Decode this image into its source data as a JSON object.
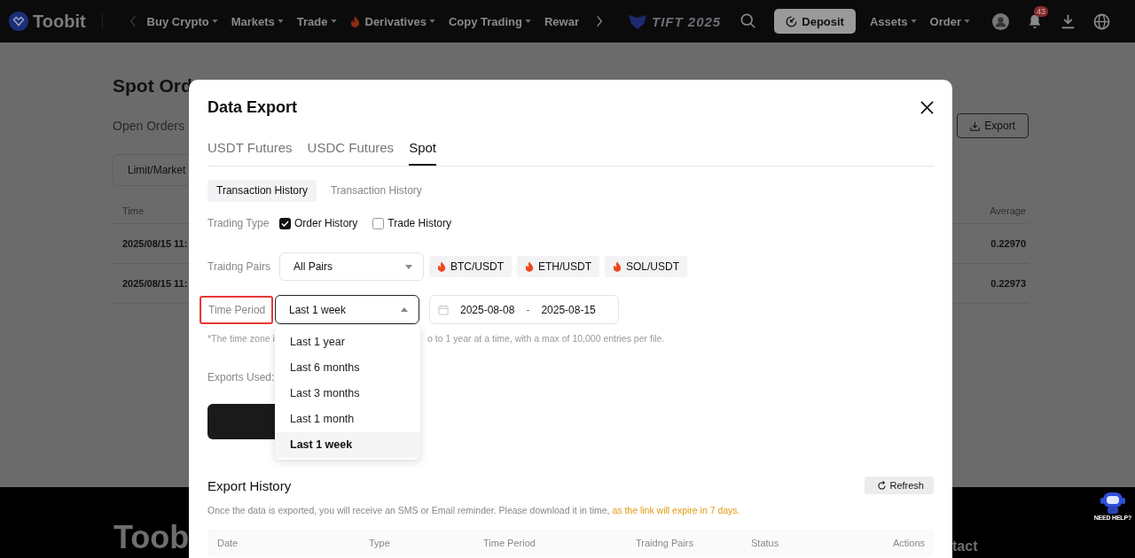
{
  "nav": {
    "logo": "Toobit",
    "items": [
      {
        "label": "Buy Crypto",
        "caret": true,
        "hot": false
      },
      {
        "label": "Markets",
        "caret": true,
        "hot": false
      },
      {
        "label": "Trade",
        "caret": true,
        "hot": false
      },
      {
        "label": "Derivatives",
        "caret": true,
        "hot": true
      },
      {
        "label": "Copy Trading",
        "caret": true,
        "hot": false
      },
      {
        "label": "Rewar",
        "caret": false,
        "hot": false
      }
    ],
    "event_logo": "TIFT 2025",
    "deposit": "Deposit",
    "menus": [
      "Assets",
      "Order"
    ],
    "notification_count": "43"
  },
  "page": {
    "title": "Spot Ord",
    "tab": "Open Orders",
    "export": "Export",
    "filter": "Limit/Market",
    "columns": [
      "Time",
      "Average"
    ],
    "rows": [
      {
        "time": "2025/08/15 11:",
        "average": "0.22970"
      },
      {
        "time": "2025/08/15 11:",
        "average": "0.22973"
      }
    ]
  },
  "footer": {
    "brand": "Toob",
    "link": "tact"
  },
  "help_badge": "NEED HELP?",
  "modal": {
    "title": "Data Export",
    "tabs": [
      {
        "label": "USDT Futures",
        "selected": false
      },
      {
        "label": "USDC Futures",
        "selected": false
      },
      {
        "label": "Spot",
        "selected": true
      }
    ],
    "sub_tabs": [
      {
        "label": "Transaction History",
        "selected": true
      },
      {
        "label": "Transaction History",
        "selected": false
      }
    ],
    "trading_type": {
      "label": "Trading Type",
      "options": [
        {
          "label": "Order History",
          "checked": true
        },
        {
          "label": "Trade History",
          "checked": false
        }
      ]
    },
    "pairs": {
      "label": "Traidng Pairs",
      "value": "All Pairs",
      "hot": [
        "BTC/USDT",
        "ETH/USDT",
        "SOL/USDT"
      ]
    },
    "period": {
      "label": "Time Period",
      "highlighted": true,
      "value": "Last 1 week",
      "expanded": true,
      "start": "2025-08-08",
      "separator": "-",
      "end": "2025-08-15",
      "options": [
        {
          "label": "Last 1 year",
          "selected": false
        },
        {
          "label": "Last 6 months",
          "selected": false
        },
        {
          "label": "Last 3 months",
          "selected": false
        },
        {
          "label": "Last 1 month",
          "selected": false
        },
        {
          "label": "Last 1 week",
          "selected": true
        }
      ]
    },
    "hint_start": "*The time zone i",
    "hint_end": "o to 1 year at a time, with a max of 10,000 entries per file.",
    "exports_used": "Exports Used:",
    "history": {
      "title": "Export History",
      "refresh": "Refresh",
      "note": "Once the data is exported, you will receive an SMS or Email reminder. Please download it in time, ",
      "note_link": "as the link will expire in 7 days.",
      "columns": [
        "Date",
        "Type",
        "Time Period",
        "Traidng Pairs",
        "Status",
        "Actions"
      ]
    }
  }
}
